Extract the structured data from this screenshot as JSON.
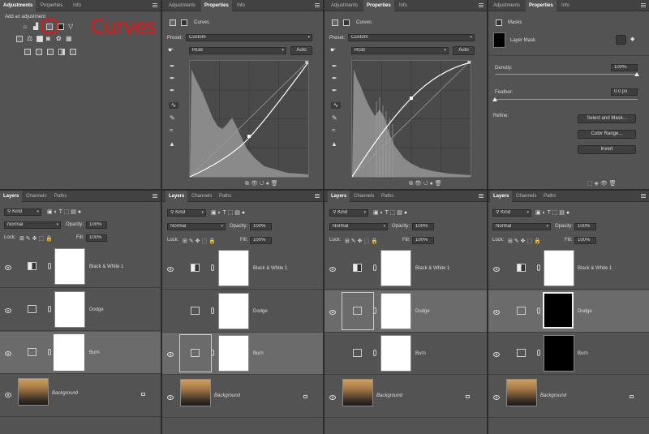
{
  "annotation": {
    "curves_label": "Curves"
  },
  "adjustments_panel": {
    "tabs": [
      "Adjustments",
      "Properties",
      "Info"
    ],
    "add_adjustment_label": "Add an adjustment"
  },
  "properties_panel": {
    "tabs": [
      "Adjustments",
      "Properties",
      "Info"
    ],
    "curves_title": "Curves",
    "preset_label": "Preset:",
    "preset_value": "Custom",
    "channel_value": "RGB",
    "auto_label": "Auto"
  },
  "masks_panel": {
    "tabs": [
      "Adjustments",
      "Properties",
      "Info"
    ],
    "title": "Masks",
    "layer_mask_label": "Layer Mask",
    "density_label": "Density:",
    "density_value": "100%",
    "feather_label": "Feather:",
    "feather_value": "0.0 px",
    "refine_label": "Refine:",
    "select_and_mask_label": "Select and Mask...",
    "color_range_label": "Color Range...",
    "invert_label": "Invert"
  },
  "layers_panel": {
    "tabs": [
      "Layers",
      "Channels",
      "Paths"
    ],
    "kind_label": "Kind",
    "blend_mode": "Normal",
    "opacity_label": "Opacity:",
    "opacity_value": "100%",
    "lock_label": "Lock:",
    "fill_label": "Fill:",
    "fill_value": "100%",
    "layers": [
      "Black & White 1",
      "Dodge",
      "Burn",
      "Background"
    ]
  },
  "colors": {
    "panel_bg": "#535353",
    "tab_bg": "#424242",
    "highlight": "#ee1111"
  }
}
